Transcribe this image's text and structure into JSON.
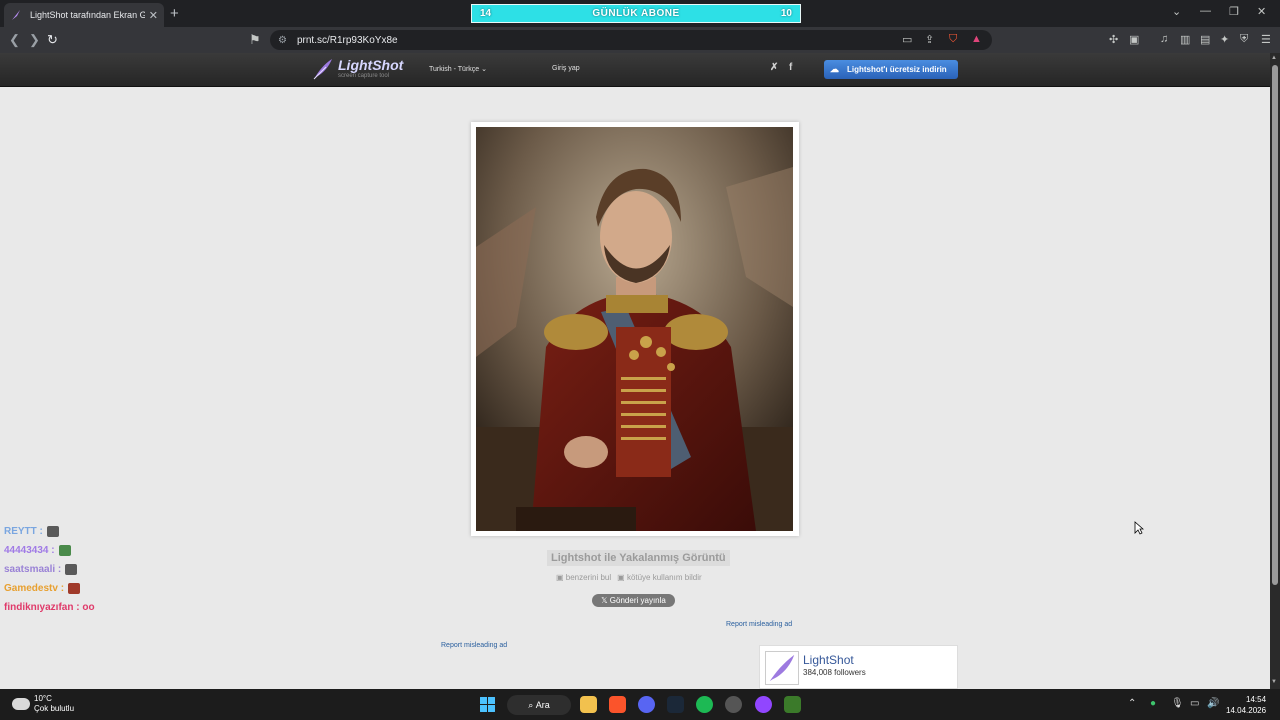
{
  "browser": {
    "tab_title": "LightShot tarafından Ekran Görü",
    "tab_close": "✕",
    "new_tab": "+",
    "url": "prnt.sc/R1rp93KoYx8e"
  },
  "overlay": {
    "left_count": "14",
    "title": "GÜNLÜK ABONE",
    "right_count": "10"
  },
  "lightshot": {
    "logo": "LightShot",
    "logo_sub": "screen capture tool",
    "language": "Turkish - Türkçe ⌄",
    "login": "Giriş yap",
    "download": "Lightshot'ı ücretsiz indirin"
  },
  "content": {
    "caption": "Lightshot ile Yakalanmış Görüntü",
    "find_similar": "benzerini bul",
    "report_abuse": "kötüye kullanım bildir",
    "post_x": "𝕏 Gönderi yayınla",
    "report_ad_1": "Report misleading ad",
    "report_ad_2": "Report misleading ad",
    "fb_name": "LightShot",
    "fb_followers": "384,008 followers"
  },
  "chat": [
    {
      "user": "REYTT :",
      "color": "#7aa6e0"
    },
    {
      "user": "44443434 :",
      "color": "#a07ae6"
    },
    {
      "user": "saatsmaali :",
      "color": "#9a82d6"
    },
    {
      "user": "Gamedestv :",
      "color": "#e8a030"
    },
    {
      "user": "findiknıyazıfan : oo",
      "color": "#e03a6a"
    }
  ],
  "taskbar": {
    "temp": "10°C",
    "weather": "Çok bulutlu",
    "search": "Ara",
    "time": "14:54",
    "date": "14.04.2026"
  },
  "colors": {
    "accent": "#2de0e6",
    "download_btn": "#3a78d0",
    "link": "#2a5f9e"
  }
}
